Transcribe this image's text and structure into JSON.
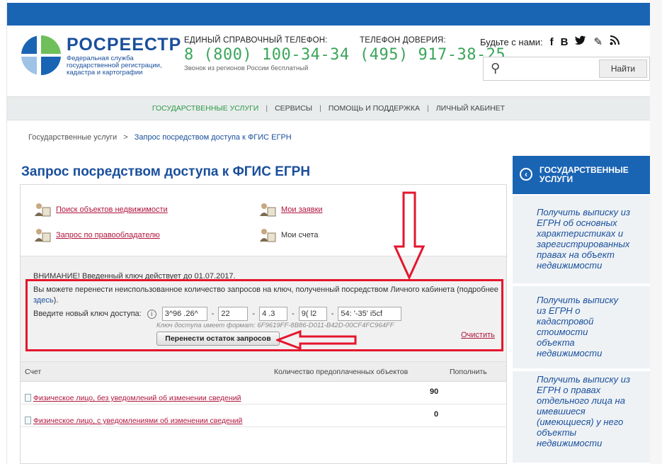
{
  "brand": {
    "name": "РОСРЕЕСТР",
    "sub": "Федеральная служба государственной регистрации, кадастра и картографии"
  },
  "hotline": {
    "label": "ЕДИНЫЙ СПРАВОЧНЫЙ ТЕЛЕФОН:",
    "number": "8 (800) 100-34-34",
    "note": "Звонок из регионов России бесплатный"
  },
  "trustline": {
    "label": "ТЕЛЕФОН ДОВЕРИЯ:",
    "number": "(495) 917-38-25"
  },
  "social": {
    "label": "Будьте с нами:",
    "icons": [
      "facebook-icon",
      "vk-icon",
      "twitter-icon",
      "blog-icon",
      "rss-icon"
    ]
  },
  "search": {
    "placeholder": "",
    "button": "Найти"
  },
  "nav": {
    "items": [
      "ГОСУДАРСТВЕННЫЕ УСЛУГИ",
      "СЕРВИСЫ",
      "ПОМОЩЬ И ПОДДЕРЖКА",
      "ЛИЧНЫЙ КАБИНЕТ"
    ]
  },
  "breadcrumb": {
    "root": "Государственные услуги",
    "sep": ">",
    "current": "Запрос посредством доступа к ФГИС ЕГРН"
  },
  "page": {
    "title": "Запрос посредством доступа к ФГИС ЕГРН"
  },
  "links": {
    "search_objects": "Поиск объектов недвижимости",
    "my_requests": "Мои заявки",
    "request_by_holder": "Запрос по правообладателю",
    "my_accounts": "Мои счета"
  },
  "warning": {
    "line1": "ВНИМАНИЕ! Введенный ключ действует до 01.07.2017.",
    "line2_pre": "Вы можете перенести неиспользованное количество запросов на ключ, полученный посредством Личного кабинета (подробнее ",
    "line2_link": "здесь",
    "line2_post": ").",
    "key_label": "Введите новый ключ доступа:",
    "key_parts": [
      "3^96 .26^",
      "22",
      "4 .3",
      "9( l2",
      "54: '-35' i5cf"
    ],
    "format_hint": "Ключ доступа имеет формат: 6F9619FF-8B86-D011-B42D-00CF4FC964FF",
    "transfer_button": "Перенести остаток запросов",
    "clear_link": "Очистить"
  },
  "table": {
    "headers": [
      "Счет",
      "Количество предоплаченных объектов",
      "Пополнить"
    ],
    "rows": [
      {
        "name": "Физическое лицо, без уведомлений об изменении сведений",
        "count": "90"
      },
      {
        "name": "Физическое лицо, с уведомлениями об изменении сведений",
        "count": "0"
      }
    ]
  },
  "sidebar": {
    "header": "ГОСУДАРСТВЕННЫЕ УСЛУГИ",
    "items": [
      "Получить выписку из ЕГРН об основных характеристиках и зарегистрированных правах на объект недвижимости",
      "Получить выписку из ЕГРН о кадастровой стоимости объекта недвижимости",
      "Получить выписку из ЕГРН о правах отдельного лица на имевшиеся (имеющиеся) у него объекты недвижимости"
    ]
  },
  "colors": {
    "brand_blue": "#1a4f9c",
    "bar_blue": "#1a64b4",
    "phone_green": "#3aa55a",
    "link_red": "#b0143c",
    "annotation_red": "#e4162d"
  }
}
